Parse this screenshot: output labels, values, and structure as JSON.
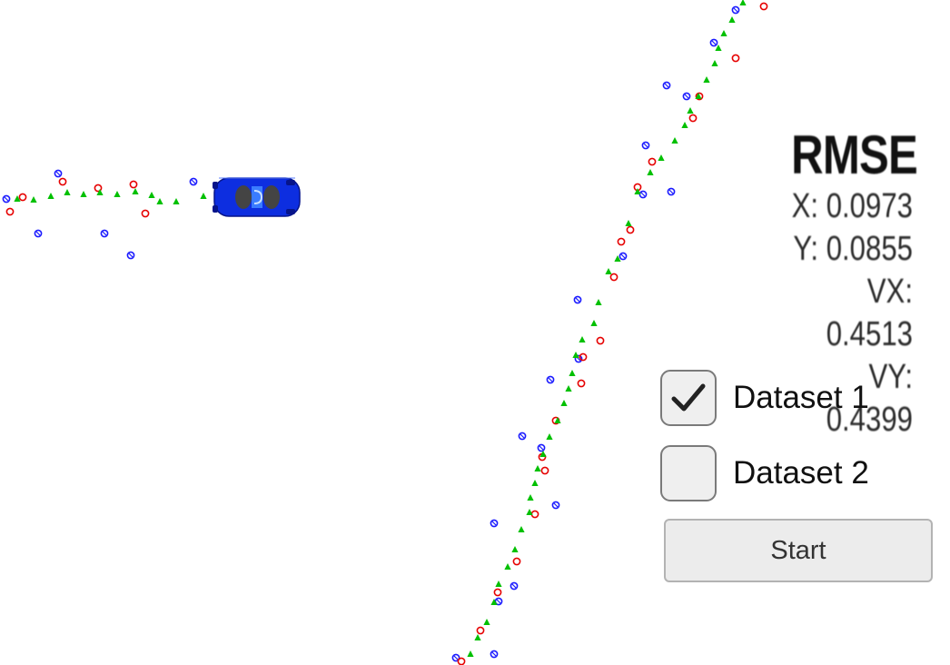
{
  "rmse": {
    "title": "RMSE",
    "x": "X: 0.0973",
    "y": "Y: 0.0855",
    "vx": "VX: 0.4513",
    "vy": "VY: 0.4399"
  },
  "datasets": [
    {
      "label": "Dataset 1",
      "checked": true
    },
    {
      "label": "Dataset 2",
      "checked": false
    }
  ],
  "start_label": "Start",
  "colors": {
    "lidar": "#1a1aff",
    "radar": "#e60000",
    "estimate": "#00c000",
    "car": "#0d2ee0"
  },
  "icons": {
    "car": "car-icon",
    "check": "check-icon"
  }
}
